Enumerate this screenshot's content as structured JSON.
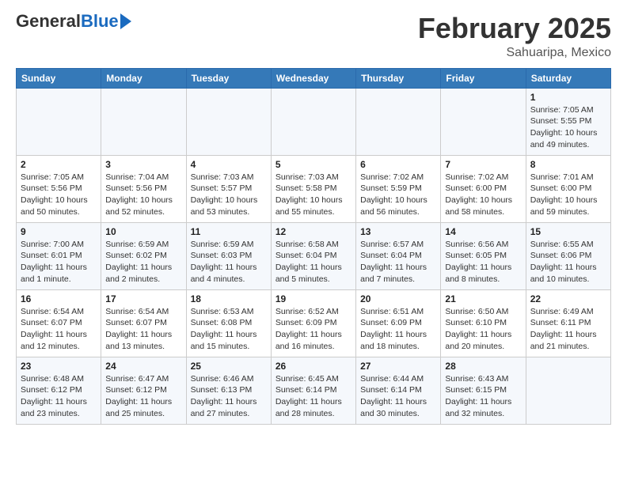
{
  "header": {
    "logo_general": "General",
    "logo_blue": "Blue",
    "month": "February 2025",
    "location": "Sahuaripa, Mexico"
  },
  "weekdays": [
    "Sunday",
    "Monday",
    "Tuesday",
    "Wednesday",
    "Thursday",
    "Friday",
    "Saturday"
  ],
  "weeks": [
    [
      {
        "day": "",
        "info": ""
      },
      {
        "day": "",
        "info": ""
      },
      {
        "day": "",
        "info": ""
      },
      {
        "day": "",
        "info": ""
      },
      {
        "day": "",
        "info": ""
      },
      {
        "day": "",
        "info": ""
      },
      {
        "day": "1",
        "info": "Sunrise: 7:05 AM\nSunset: 5:55 PM\nDaylight: 10 hours\nand 49 minutes."
      }
    ],
    [
      {
        "day": "2",
        "info": "Sunrise: 7:05 AM\nSunset: 5:56 PM\nDaylight: 10 hours\nand 50 minutes."
      },
      {
        "day": "3",
        "info": "Sunrise: 7:04 AM\nSunset: 5:56 PM\nDaylight: 10 hours\nand 52 minutes."
      },
      {
        "day": "4",
        "info": "Sunrise: 7:03 AM\nSunset: 5:57 PM\nDaylight: 10 hours\nand 53 minutes."
      },
      {
        "day": "5",
        "info": "Sunrise: 7:03 AM\nSunset: 5:58 PM\nDaylight: 10 hours\nand 55 minutes."
      },
      {
        "day": "6",
        "info": "Sunrise: 7:02 AM\nSunset: 5:59 PM\nDaylight: 10 hours\nand 56 minutes."
      },
      {
        "day": "7",
        "info": "Sunrise: 7:02 AM\nSunset: 6:00 PM\nDaylight: 10 hours\nand 58 minutes."
      },
      {
        "day": "8",
        "info": "Sunrise: 7:01 AM\nSunset: 6:00 PM\nDaylight: 10 hours\nand 59 minutes."
      }
    ],
    [
      {
        "day": "9",
        "info": "Sunrise: 7:00 AM\nSunset: 6:01 PM\nDaylight: 11 hours\nand 1 minute."
      },
      {
        "day": "10",
        "info": "Sunrise: 6:59 AM\nSunset: 6:02 PM\nDaylight: 11 hours\nand 2 minutes."
      },
      {
        "day": "11",
        "info": "Sunrise: 6:59 AM\nSunset: 6:03 PM\nDaylight: 11 hours\nand 4 minutes."
      },
      {
        "day": "12",
        "info": "Sunrise: 6:58 AM\nSunset: 6:04 PM\nDaylight: 11 hours\nand 5 minutes."
      },
      {
        "day": "13",
        "info": "Sunrise: 6:57 AM\nSunset: 6:04 PM\nDaylight: 11 hours\nand 7 minutes."
      },
      {
        "day": "14",
        "info": "Sunrise: 6:56 AM\nSunset: 6:05 PM\nDaylight: 11 hours\nand 8 minutes."
      },
      {
        "day": "15",
        "info": "Sunrise: 6:55 AM\nSunset: 6:06 PM\nDaylight: 11 hours\nand 10 minutes."
      }
    ],
    [
      {
        "day": "16",
        "info": "Sunrise: 6:54 AM\nSunset: 6:07 PM\nDaylight: 11 hours\nand 12 minutes."
      },
      {
        "day": "17",
        "info": "Sunrise: 6:54 AM\nSunset: 6:07 PM\nDaylight: 11 hours\nand 13 minutes."
      },
      {
        "day": "18",
        "info": "Sunrise: 6:53 AM\nSunset: 6:08 PM\nDaylight: 11 hours\nand 15 minutes."
      },
      {
        "day": "19",
        "info": "Sunrise: 6:52 AM\nSunset: 6:09 PM\nDaylight: 11 hours\nand 16 minutes."
      },
      {
        "day": "20",
        "info": "Sunrise: 6:51 AM\nSunset: 6:09 PM\nDaylight: 11 hours\nand 18 minutes."
      },
      {
        "day": "21",
        "info": "Sunrise: 6:50 AM\nSunset: 6:10 PM\nDaylight: 11 hours\nand 20 minutes."
      },
      {
        "day": "22",
        "info": "Sunrise: 6:49 AM\nSunset: 6:11 PM\nDaylight: 11 hours\nand 21 minutes."
      }
    ],
    [
      {
        "day": "23",
        "info": "Sunrise: 6:48 AM\nSunset: 6:12 PM\nDaylight: 11 hours\nand 23 minutes."
      },
      {
        "day": "24",
        "info": "Sunrise: 6:47 AM\nSunset: 6:12 PM\nDaylight: 11 hours\nand 25 minutes."
      },
      {
        "day": "25",
        "info": "Sunrise: 6:46 AM\nSunset: 6:13 PM\nDaylight: 11 hours\nand 27 minutes."
      },
      {
        "day": "26",
        "info": "Sunrise: 6:45 AM\nSunset: 6:14 PM\nDaylight: 11 hours\nand 28 minutes."
      },
      {
        "day": "27",
        "info": "Sunrise: 6:44 AM\nSunset: 6:14 PM\nDaylight: 11 hours\nand 30 minutes."
      },
      {
        "day": "28",
        "info": "Sunrise: 6:43 AM\nSunset: 6:15 PM\nDaylight: 11 hours\nand 32 minutes."
      },
      {
        "day": "",
        "info": ""
      }
    ]
  ]
}
